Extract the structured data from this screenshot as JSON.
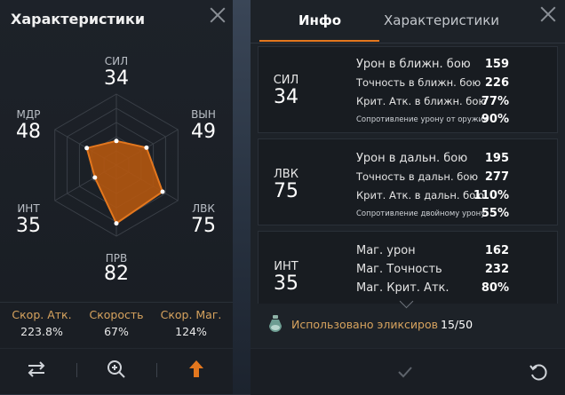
{
  "left_panel": {
    "title": "Характеристики",
    "stats": [
      {
        "abbr": "СИЛ",
        "value": "34"
      },
      {
        "abbr": "ВЫН",
        "value": "49"
      },
      {
        "abbr": "ЛВК",
        "value": "75"
      },
      {
        "abbr": "ПРВ",
        "value": "82"
      },
      {
        "abbr": "ИНТ",
        "value": "35"
      },
      {
        "abbr": "МДР",
        "value": "48"
      }
    ],
    "radar_levels": [
      0.34,
      0.49,
      0.75,
      0.82,
      0.35,
      0.48
    ],
    "speeds": [
      {
        "label": "Скор. Атк.",
        "value": "223.8%"
      },
      {
        "label": "Скорость",
        "value": "67%"
      },
      {
        "label": "Скор. Маг.",
        "value": "124%"
      }
    ],
    "toolbar": {
      "icons": [
        "swap-arrows-icon",
        "zoom-in-icon",
        "upgrade-arrow-icon"
      ]
    }
  },
  "right_panel": {
    "tabs": [
      {
        "label": "Инфо",
        "active": true
      },
      {
        "label": "Характеристики",
        "active": false
      }
    ],
    "sections": [
      {
        "abbr": "СИЛ",
        "value": "34",
        "rows": [
          {
            "name": "Урон в ближн. бою",
            "value": "159"
          },
          {
            "name": "Точность в ближн. бою",
            "value": "226"
          },
          {
            "name": "Крит. Атк. в ближн. бою",
            "value": "77%"
          },
          {
            "name": "Сопротивление урону от оружия",
            "value": "90%"
          }
        ]
      },
      {
        "abbr": "ЛВК",
        "value": "75",
        "rows": [
          {
            "name": "Урон в дальн. бою",
            "value": "195"
          },
          {
            "name": "Точность в дальн. бою",
            "value": "277"
          },
          {
            "name": "Крит. Атк. в дальн. бою",
            "value": "110%"
          },
          {
            "name": "Сопротивление двойному урону",
            "value": "55%"
          }
        ]
      },
      {
        "abbr": "ИНТ",
        "value": "35",
        "rows": [
          {
            "name": "Маг. урон",
            "value": "162"
          },
          {
            "name": "Маг. Точность",
            "value": "232"
          },
          {
            "name": "Маг. Крит. Атк.",
            "value": "80%"
          }
        ]
      }
    ],
    "elixir": {
      "label": "Использовано эликсиров",
      "value": "15/50"
    },
    "toolbar": {
      "icons": [
        "checkmark-icon",
        "reset-icon"
      ]
    }
  },
  "colors": {
    "accent": "#e3771e",
    "radar_fill": "#b4560f",
    "gold_text": "#d7a35e"
  }
}
